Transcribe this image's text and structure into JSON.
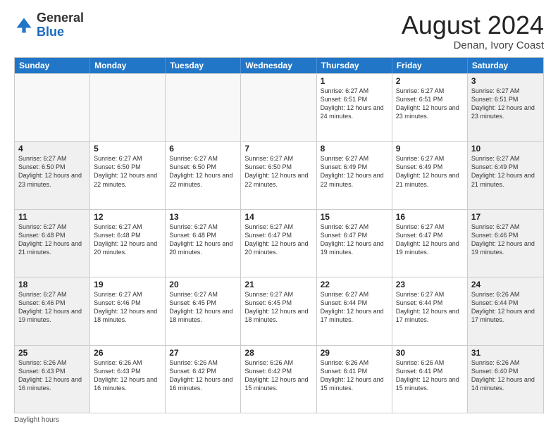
{
  "logo": {
    "general": "General",
    "blue": "Blue"
  },
  "header": {
    "month": "August 2024",
    "location": "Denan, Ivory Coast"
  },
  "days": [
    "Sunday",
    "Monday",
    "Tuesday",
    "Wednesday",
    "Thursday",
    "Friday",
    "Saturday"
  ],
  "footer": {
    "daylight_label": "Daylight hours"
  },
  "weeks": [
    [
      {
        "day": "",
        "content": ""
      },
      {
        "day": "",
        "content": ""
      },
      {
        "day": "",
        "content": ""
      },
      {
        "day": "",
        "content": ""
      },
      {
        "day": "1",
        "content": "Sunrise: 6:27 AM\nSunset: 6:51 PM\nDaylight: 12 hours and 24 minutes."
      },
      {
        "day": "2",
        "content": "Sunrise: 6:27 AM\nSunset: 6:51 PM\nDaylight: 12 hours and 23 minutes."
      },
      {
        "day": "3",
        "content": "Sunrise: 6:27 AM\nSunset: 6:51 PM\nDaylight: 12 hours and 23 minutes."
      }
    ],
    [
      {
        "day": "4",
        "content": "Sunrise: 6:27 AM\nSunset: 6:50 PM\nDaylight: 12 hours and 23 minutes."
      },
      {
        "day": "5",
        "content": "Sunrise: 6:27 AM\nSunset: 6:50 PM\nDaylight: 12 hours and 22 minutes."
      },
      {
        "day": "6",
        "content": "Sunrise: 6:27 AM\nSunset: 6:50 PM\nDaylight: 12 hours and 22 minutes."
      },
      {
        "day": "7",
        "content": "Sunrise: 6:27 AM\nSunset: 6:50 PM\nDaylight: 12 hours and 22 minutes."
      },
      {
        "day": "8",
        "content": "Sunrise: 6:27 AM\nSunset: 6:49 PM\nDaylight: 12 hours and 22 minutes."
      },
      {
        "day": "9",
        "content": "Sunrise: 6:27 AM\nSunset: 6:49 PM\nDaylight: 12 hours and 21 minutes."
      },
      {
        "day": "10",
        "content": "Sunrise: 6:27 AM\nSunset: 6:49 PM\nDaylight: 12 hours and 21 minutes."
      }
    ],
    [
      {
        "day": "11",
        "content": "Sunrise: 6:27 AM\nSunset: 6:48 PM\nDaylight: 12 hours and 21 minutes."
      },
      {
        "day": "12",
        "content": "Sunrise: 6:27 AM\nSunset: 6:48 PM\nDaylight: 12 hours and 20 minutes."
      },
      {
        "day": "13",
        "content": "Sunrise: 6:27 AM\nSunset: 6:48 PM\nDaylight: 12 hours and 20 minutes."
      },
      {
        "day": "14",
        "content": "Sunrise: 6:27 AM\nSunset: 6:47 PM\nDaylight: 12 hours and 20 minutes."
      },
      {
        "day": "15",
        "content": "Sunrise: 6:27 AM\nSunset: 6:47 PM\nDaylight: 12 hours and 19 minutes."
      },
      {
        "day": "16",
        "content": "Sunrise: 6:27 AM\nSunset: 6:47 PM\nDaylight: 12 hours and 19 minutes."
      },
      {
        "day": "17",
        "content": "Sunrise: 6:27 AM\nSunset: 6:46 PM\nDaylight: 12 hours and 19 minutes."
      }
    ],
    [
      {
        "day": "18",
        "content": "Sunrise: 6:27 AM\nSunset: 6:46 PM\nDaylight: 12 hours and 19 minutes."
      },
      {
        "day": "19",
        "content": "Sunrise: 6:27 AM\nSunset: 6:46 PM\nDaylight: 12 hours and 18 minutes."
      },
      {
        "day": "20",
        "content": "Sunrise: 6:27 AM\nSunset: 6:45 PM\nDaylight: 12 hours and 18 minutes."
      },
      {
        "day": "21",
        "content": "Sunrise: 6:27 AM\nSunset: 6:45 PM\nDaylight: 12 hours and 18 minutes."
      },
      {
        "day": "22",
        "content": "Sunrise: 6:27 AM\nSunset: 6:44 PM\nDaylight: 12 hours and 17 minutes."
      },
      {
        "day": "23",
        "content": "Sunrise: 6:27 AM\nSunset: 6:44 PM\nDaylight: 12 hours and 17 minutes."
      },
      {
        "day": "24",
        "content": "Sunrise: 6:26 AM\nSunset: 6:44 PM\nDaylight: 12 hours and 17 minutes."
      }
    ],
    [
      {
        "day": "25",
        "content": "Sunrise: 6:26 AM\nSunset: 6:43 PM\nDaylight: 12 hours and 16 minutes."
      },
      {
        "day": "26",
        "content": "Sunrise: 6:26 AM\nSunset: 6:43 PM\nDaylight: 12 hours and 16 minutes."
      },
      {
        "day": "27",
        "content": "Sunrise: 6:26 AM\nSunset: 6:42 PM\nDaylight: 12 hours and 16 minutes."
      },
      {
        "day": "28",
        "content": "Sunrise: 6:26 AM\nSunset: 6:42 PM\nDaylight: 12 hours and 15 minutes."
      },
      {
        "day": "29",
        "content": "Sunrise: 6:26 AM\nSunset: 6:41 PM\nDaylight: 12 hours and 15 minutes."
      },
      {
        "day": "30",
        "content": "Sunrise: 6:26 AM\nSunset: 6:41 PM\nDaylight: 12 hours and 15 minutes."
      },
      {
        "day": "31",
        "content": "Sunrise: 6:26 AM\nSunset: 6:40 PM\nDaylight: 12 hours and 14 minutes."
      }
    ]
  ]
}
